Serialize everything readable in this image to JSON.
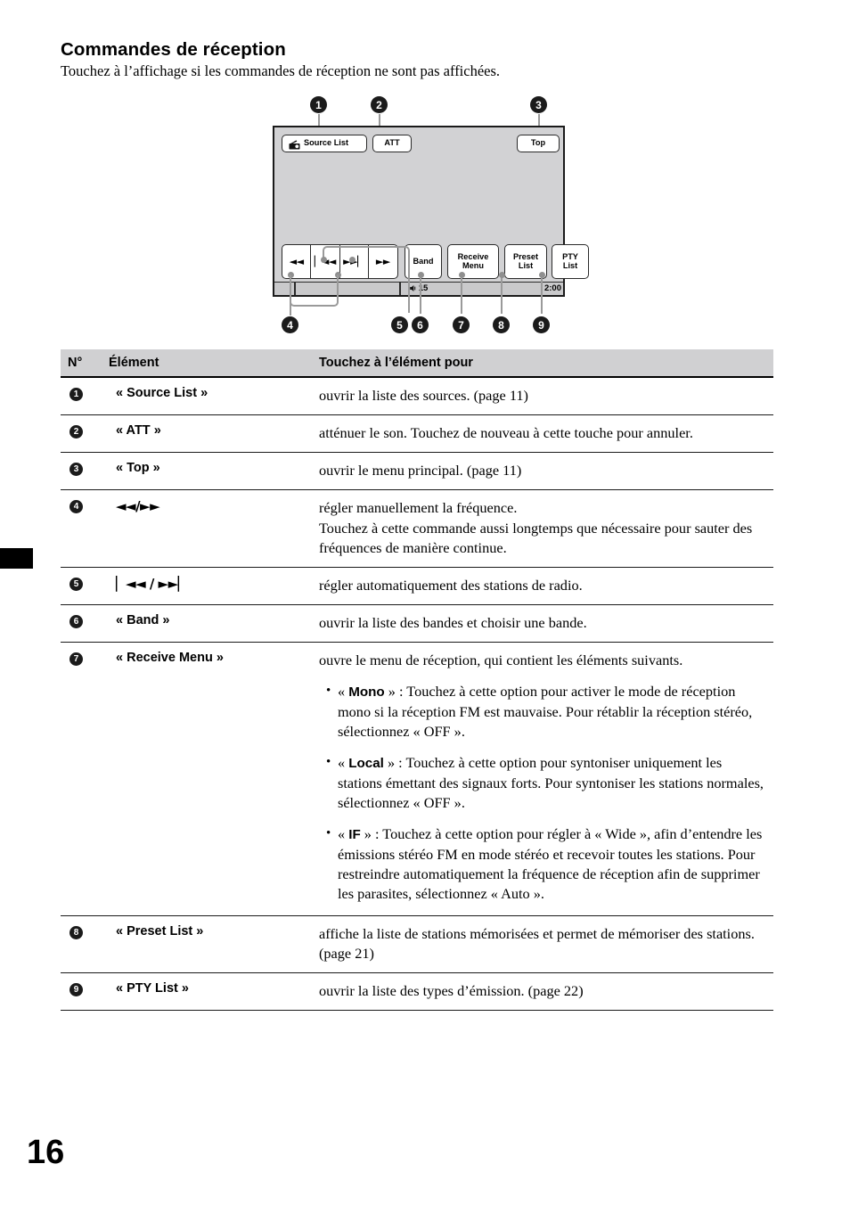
{
  "heading": "Commandes de réception",
  "subheading": "Touchez à l’affichage si les commandes de réception ne sont pas affichées.",
  "page_number": "16",
  "figure": {
    "callouts": [
      "1",
      "2",
      "3",
      "4",
      "5",
      "6",
      "7",
      "8",
      "9"
    ],
    "device": {
      "source_list_label": "Source List",
      "att_label": "ATT",
      "top_label": "Top",
      "transport": [
        "◄◄",
        "▏◄◄",
        "►►▏",
        "►►"
      ],
      "band_label": "Band",
      "receive_menu_line1": "Receive",
      "receive_menu_line2": "Menu",
      "preset_list_line1": "Preset",
      "preset_list_line2": "List",
      "pty_list_line1": "PTY",
      "pty_list_line2": "List",
      "volume_value": "15",
      "clock": "2:00"
    }
  },
  "table": {
    "headers": {
      "num": "N°",
      "element": "Élément",
      "description": "Touchez à l’élément pour"
    },
    "rows": [
      {
        "num": "1",
        "element": "« Source List »",
        "desc": "ouvrir la liste des sources. (page 11)"
      },
      {
        "num": "2",
        "element": "« ATT »",
        "desc": "atténuer le son. Touchez de nouveau à cette touche pour annuler."
      },
      {
        "num": "3",
        "element": "« Top »",
        "desc": "ouvrir le menu principal. (page 11)"
      },
      {
        "num": "4",
        "element": "◄◄/►►",
        "desc": "régler manuellement la fréquence.",
        "desc2": "Touchez à cette commande aussi longtemps que nécessaire pour sauter des fréquences de manière continue."
      },
      {
        "num": "5",
        "element": "▏◄◄ / ►►▏",
        "desc": "régler automatiquement des stations de radio."
      },
      {
        "num": "6",
        "element": "« Band »",
        "desc": "ouvrir la liste des bandes et choisir une bande."
      },
      {
        "num": "7",
        "element": "« Receive Menu »",
        "desc": "ouvre le menu de réception, qui contient les éléments suivants.",
        "bullets": [
          {
            "prefix": "« ",
            "keyword": "Mono",
            "suffix": " » : Touchez à cette option pour activer le mode de réception mono si la réception FM est mauvaise. Pour rétablir la réception stéréo, sélectionnez « OFF »."
          },
          {
            "prefix": "« ",
            "keyword": "Local",
            "suffix": " » : Touchez à cette option pour syntoniser uniquement les stations émettant des signaux forts. Pour syntoniser les stations normales, sélectionnez « OFF »."
          },
          {
            "prefix": "« ",
            "keyword": "IF",
            "suffix": " » : Touchez à cette option pour régler à « Wide », afin d’entendre les émissions stéréo FM en mode stéréo et recevoir toutes les stations. Pour restreindre automatiquement la fréquence de réception afin de supprimer les parasites, sélectionnez « Auto »."
          }
        ]
      },
      {
        "num": "8",
        "element": "« Preset List »",
        "desc": "affiche la liste de stations mémorisées et permet de mémoriser des stations. (page 21)"
      },
      {
        "num": "9",
        "element": "« PTY List »",
        "desc": "ouvrir la liste des types d’émission. (page 22)"
      }
    ]
  }
}
